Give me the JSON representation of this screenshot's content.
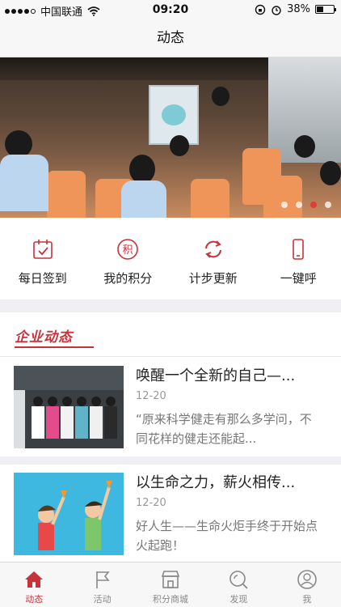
{
  "status_bar": {
    "carrier": "中国联通",
    "time": "09:20",
    "battery": "38%",
    "battery_level": 0.38
  },
  "nav": {
    "title": "动态"
  },
  "banner": {
    "slides": 4,
    "active_index": 2
  },
  "quick_actions": [
    {
      "label": "每日签到",
      "icon": "calendar-check-icon"
    },
    {
      "label": "我的积分",
      "icon": "points-icon",
      "glyph": "积"
    },
    {
      "label": "计步更新",
      "icon": "refresh-icon"
    },
    {
      "label": "一键呼",
      "icon": "phone-icon"
    }
  ],
  "section": {
    "title": "企业动态"
  },
  "news": [
    {
      "title": "唤醒一个全新的自己—...",
      "date": "12-20",
      "summary": "“原来科学健走有那么多学问，不同花样的健走还能起..."
    },
    {
      "title": "以生命之力，薪火相传...",
      "date": "12-20",
      "summary": "好人生——生命火炬手终于开始点火起跑！"
    }
  ],
  "tabbar": [
    {
      "label": "动态",
      "icon": "home-icon",
      "active": true
    },
    {
      "label": "活动",
      "icon": "flag-icon",
      "active": false
    },
    {
      "label": "积分商城",
      "icon": "shop-icon",
      "active": false
    },
    {
      "label": "发现",
      "icon": "discover-icon",
      "active": false
    },
    {
      "label": "我",
      "icon": "profile-icon",
      "active": false
    }
  ],
  "colors": {
    "accent": "#c8323a",
    "text": "#222222",
    "muted": "#999999",
    "background": "#efeff4"
  }
}
